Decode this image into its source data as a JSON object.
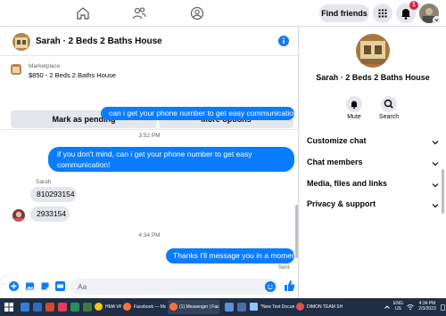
{
  "topbar": {
    "find_friends": "Find friends",
    "notification_count": "1"
  },
  "chat": {
    "title": "Sarah · 2 Beds 2 Baths House",
    "listing": {
      "label": "Marketplace",
      "detail": "$850 - 2 Beds 2 Baths House"
    },
    "buttons": {
      "mark_pending": "Mark as pending",
      "more_options": "More options"
    },
    "messages": {
      "m1": "can i get your phone number to get easy communication",
      "time1": "3:52 PM",
      "m2_line1": "if you don't mind, can i get your phone number to get easy",
      "m2_line2": "communication!",
      "sender": "Sarah",
      "m3": "810293154",
      "m4": "2933154",
      "time2": "4:34 PM",
      "m5": "Thanks I'll message you in a moment",
      "status": "Sent"
    },
    "composer_placeholder": "Aa"
  },
  "info_panel": {
    "name": "Sarah · 2 Beds 2 Baths House",
    "mute": "Mute",
    "search": "Search",
    "rows": [
      "Customize chat",
      "Chat members",
      "Media, files and links",
      "Privacy & support"
    ]
  },
  "taskbar": {
    "apps": [
      "HMA VPN",
      "Facebook — Mozilla Fir",
      "(1) Messenger | Faceboo",
      "*New Text Document (3",
      "DIMON TEAM SHEETS -"
    ],
    "lang_top": "ENG",
    "lang_bottom": "US",
    "time": "4:34 PM",
    "date": "2/3/2023"
  },
  "colors": {
    "accent": "#0a7cff",
    "brand": "#1877f2",
    "taskbar": "#1f2d45"
  }
}
